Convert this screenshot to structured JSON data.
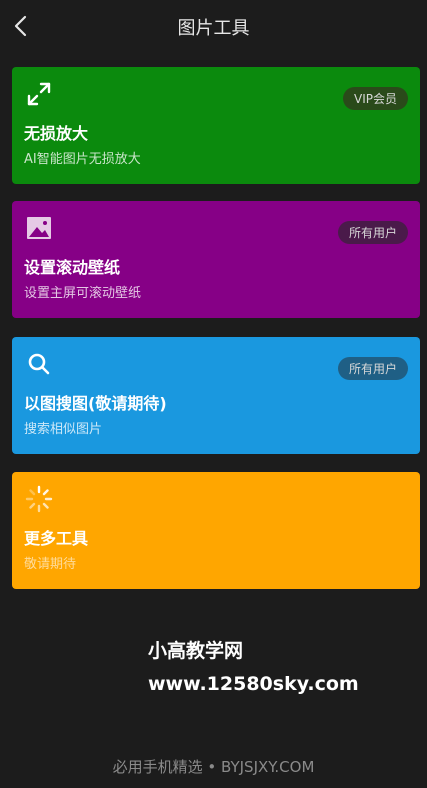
{
  "header": {
    "title": "图片工具"
  },
  "cards": [
    {
      "title": "无损放大",
      "subtitle": "AI智能图片无损放大",
      "badge": "VIP会员",
      "icon": "expand-icon",
      "color": "#0b8a0d"
    },
    {
      "title": "设置滚动壁纸",
      "subtitle": "设置主屏可滚动壁纸",
      "badge": "所有用户",
      "icon": "image-icon",
      "color": "#860086"
    },
    {
      "title": "以图搜图(敬请期待)",
      "subtitle": "搜索相似图片",
      "badge": "所有用户",
      "icon": "search-icon",
      "color": "#1a98df"
    },
    {
      "title": "更多工具",
      "subtitle": "敬请期待",
      "icon": "loading-icon",
      "color": "#ffa600"
    }
  ],
  "watermark": {
    "line1": "小高教学网",
    "line2": "www.12580sky.com"
  },
  "footer": {
    "text": "必用手机精选 • BYJSJXY.COM"
  }
}
